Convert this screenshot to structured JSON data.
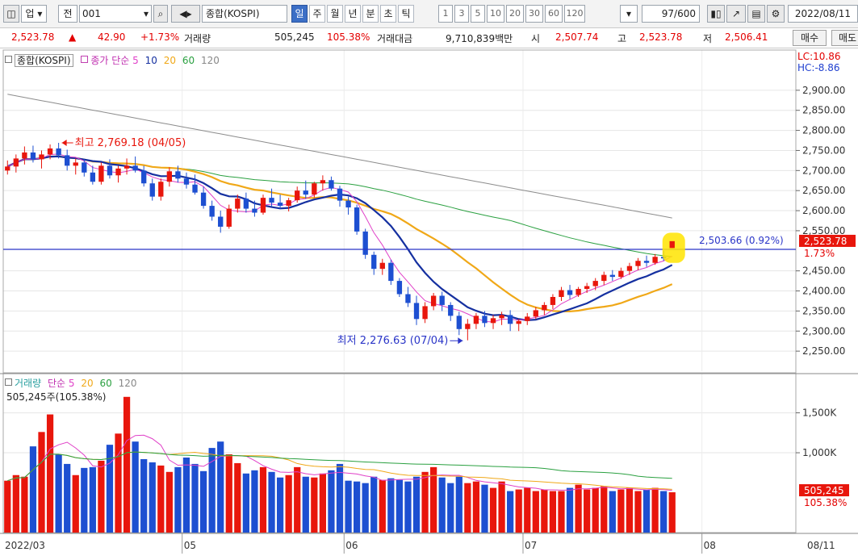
{
  "toolbar": {
    "market": "업",
    "type": "전",
    "code": "001",
    "name": "종합(KOSPI)",
    "periods": [
      "일",
      "주",
      "월",
      "년",
      "분",
      "초",
      "틱"
    ],
    "active_period": "일",
    "intervals": [
      "1",
      "3",
      "5",
      "10",
      "20",
      "30",
      "60",
      "120"
    ],
    "count": "97",
    "count_total": "/600",
    "date": "2022/08/11"
  },
  "quote": {
    "price": "2,523.78",
    "change_arrow": "▲",
    "change": "42.90",
    "change_pct": "+1.73%",
    "vol_label": "거래량",
    "volume": "505,245",
    "vol_pct": "105.38%",
    "amt_label": "거래대금",
    "amount": "9,710,839백만",
    "open_label": "시",
    "open": "2,507.74",
    "high_label": "고",
    "high": "2,523.78",
    "low_label": "저",
    "low": "2,506.41",
    "buy_label": "매수",
    "sell_label": "매도"
  },
  "price_panel": {
    "legend_name": "종합(KOSPI)",
    "ma_label": "종가 단순",
    "ma_periods": [
      "5",
      "10",
      "20",
      "60",
      "120"
    ],
    "lc": "LC:10.86",
    "hc": "HC:-8.86",
    "high_note": "최고 2,769.18 (04/05)",
    "low_note": "최저 2,276.63 (07/04)",
    "hline_label": "2,503.66 (0.92%)",
    "last_price": "2,523.78",
    "last_pct": "1.73%",
    "ticks": [
      "2,900.00",
      "2,850.00",
      "2,800.00",
      "2,750.00",
      "2,700.00",
      "2,650.00",
      "2,600.00",
      "2,550.00",
      "2,450.00",
      "2,400.00",
      "2,350.00",
      "2,300.00",
      "2,250.00"
    ]
  },
  "volume_panel": {
    "label": "거래량",
    "ma_label": "단순",
    "ma_periods": [
      "5",
      "20",
      "60",
      "120"
    ],
    "current": "505,245주(105.38%)",
    "ticks": [
      "1,500K",
      "1,000K"
    ],
    "last_vol": "505,245",
    "last_pct": "105.38%"
  },
  "x_axis": [
    "2022/03",
    "05",
    "06",
    "07",
    "08"
  ],
  "x_axis_right": "08/11",
  "colors": {
    "up": "#e8160c",
    "down": "#1d4fd1",
    "ma5": "#e040c8",
    "ma10": "#1530a0",
    "ma20": "#f0a818",
    "ma60": "#2aa040",
    "ma120": "#8c8c8c",
    "hline": "#2a35c8"
  },
  "chart_data": {
    "type": "candlestick",
    "ylim": [
      2200,
      2960
    ],
    "ohlc": [
      [
        2700,
        2725,
        2690,
        2710
      ],
      [
        2710,
        2740,
        2695,
        2730
      ],
      [
        2730,
        2760,
        2715,
        2745
      ],
      [
        2745,
        2762,
        2720,
        2728
      ],
      [
        2728,
        2750,
        2705,
        2740
      ],
      [
        2740,
        2765,
        2728,
        2755
      ],
      [
        2755,
        2769,
        2730,
        2738
      ],
      [
        2738,
        2752,
        2700,
        2712
      ],
      [
        2712,
        2730,
        2690,
        2720
      ],
      [
        2720,
        2728,
        2685,
        2695
      ],
      [
        2695,
        2712,
        2665,
        2672
      ],
      [
        2672,
        2720,
        2665,
        2712
      ],
      [
        2712,
        2728,
        2680,
        2688
      ],
      [
        2688,
        2712,
        2670,
        2705
      ],
      [
        2705,
        2730,
        2690,
        2712
      ],
      [
        2712,
        2735,
        2695,
        2700
      ],
      [
        2700,
        2712,
        2660,
        2668
      ],
      [
        2668,
        2680,
        2625,
        2635
      ],
      [
        2635,
        2680,
        2625,
        2672
      ],
      [
        2672,
        2708,
        2660,
        2698
      ],
      [
        2698,
        2712,
        2670,
        2680
      ],
      [
        2680,
        2695,
        2655,
        2665
      ],
      [
        2665,
        2690,
        2640,
        2645
      ],
      [
        2645,
        2660,
        2605,
        2612
      ],
      [
        2612,
        2625,
        2575,
        2585
      ],
      [
        2585,
        2600,
        2545,
        2560
      ],
      [
        2560,
        2615,
        2555,
        2605
      ],
      [
        2605,
        2640,
        2595,
        2630
      ],
      [
        2630,
        2645,
        2595,
        2605
      ],
      [
        2605,
        2625,
        2585,
        2595
      ],
      [
        2595,
        2640,
        2590,
        2632
      ],
      [
        2632,
        2655,
        2610,
        2620
      ],
      [
        2620,
        2640,
        2605,
        2612
      ],
      [
        2612,
        2632,
        2598,
        2626
      ],
      [
        2626,
        2660,
        2620,
        2650
      ],
      [
        2650,
        2675,
        2630,
        2640
      ],
      [
        2640,
        2672,
        2632,
        2668
      ],
      [
        2668,
        2688,
        2650,
        2676
      ],
      [
        2676,
        2685,
        2650,
        2655
      ],
      [
        2655,
        2662,
        2610,
        2625
      ],
      [
        2625,
        2635,
        2590,
        2608
      ],
      [
        2608,
        2615,
        2540,
        2548
      ],
      [
        2548,
        2555,
        2480,
        2490
      ],
      [
        2490,
        2498,
        2440,
        2455
      ],
      [
        2455,
        2480,
        2440,
        2470
      ],
      [
        2470,
        2478,
        2415,
        2425
      ],
      [
        2425,
        2432,
        2385,
        2392
      ],
      [
        2392,
        2410,
        2360,
        2370
      ],
      [
        2370,
        2388,
        2315,
        2330
      ],
      [
        2330,
        2372,
        2320,
        2362
      ],
      [
        2362,
        2395,
        2352,
        2388
      ],
      [
        2388,
        2398,
        2350,
        2365
      ],
      [
        2365,
        2372,
        2325,
        2338
      ],
      [
        2338,
        2348,
        2290,
        2305
      ],
      [
        2305,
        2330,
        2277,
        2318
      ],
      [
        2318,
        2345,
        2305,
        2338
      ],
      [
        2338,
        2350,
        2310,
        2320
      ],
      [
        2320,
        2340,
        2305,
        2332
      ],
      [
        2332,
        2348,
        2315,
        2340
      ],
      [
        2340,
        2352,
        2300,
        2318
      ],
      [
        2318,
        2330,
        2300,
        2325
      ],
      [
        2325,
        2345,
        2315,
        2336
      ],
      [
        2336,
        2360,
        2330,
        2352
      ],
      [
        2352,
        2372,
        2340,
        2365
      ],
      [
        2365,
        2392,
        2355,
        2385
      ],
      [
        2385,
        2410,
        2375,
        2402
      ],
      [
        2402,
        2415,
        2380,
        2390
      ],
      [
        2390,
        2410,
        2385,
        2405
      ],
      [
        2405,
        2420,
        2395,
        2412
      ],
      [
        2412,
        2432,
        2402,
        2425
      ],
      [
        2425,
        2448,
        2415,
        2440
      ],
      [
        2440,
        2452,
        2425,
        2435
      ],
      [
        2435,
        2458,
        2430,
        2450
      ],
      [
        2450,
        2470,
        2440,
        2462
      ],
      [
        2462,
        2482,
        2452,
        2475
      ],
      [
        2475,
        2488,
        2460,
        2470
      ],
      [
        2470,
        2492,
        2465,
        2485
      ],
      [
        2485,
        2500,
        2475,
        2481
      ],
      [
        2507,
        2524,
        2506,
        2524
      ]
    ],
    "volume_k": [
      650,
      720,
      700,
      1080,
      1260,
      1480,
      980,
      860,
      720,
      810,
      820,
      900,
      1100,
      1240,
      1700,
      1140,
      920,
      880,
      840,
      760,
      820,
      940,
      860,
      770,
      1060,
      1140,
      980,
      870,
      740,
      780,
      820,
      760,
      690,
      720,
      820,
      700,
      690,
      740,
      780,
      860,
      650,
      640,
      620,
      700,
      660,
      680,
      660,
      640,
      700,
      760,
      820,
      690,
      620,
      700,
      620,
      640,
      600,
      560,
      640,
      520,
      540,
      560,
      520,
      540,
      520,
      520,
      560,
      600,
      540,
      560,
      580,
      520,
      540,
      560,
      520,
      540,
      560,
      520,
      505
    ]
  }
}
